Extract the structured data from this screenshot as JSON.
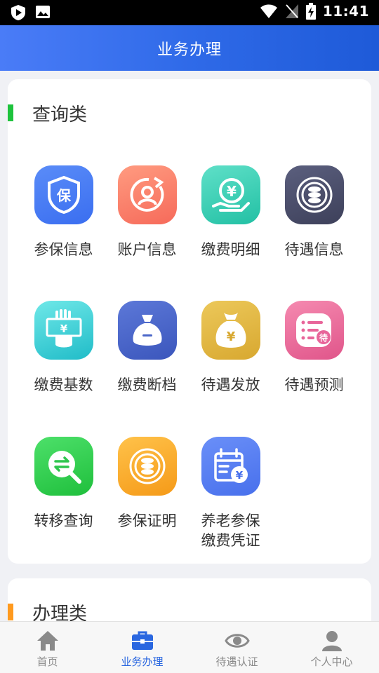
{
  "status_bar": {
    "time": "11:41"
  },
  "header": {
    "title": "业务办理"
  },
  "query_section": {
    "title": "查询类",
    "items": [
      {
        "label": "参保信息",
        "icon": "shield-bao-icon",
        "color_from": "#5a8cf8",
        "color_to": "#3a6ef0"
      },
      {
        "label": "账户信息",
        "icon": "account-cycle-icon",
        "color_from": "#ff9b80",
        "color_to": "#f66a5a"
      },
      {
        "label": "缴费明细",
        "icon": "yuan-hand-icon",
        "color_from": "#5fe0c8",
        "color_to": "#22c0a4"
      },
      {
        "label": "待遇信息",
        "icon": "coin-stack-icon",
        "color_from": "#5b5f7e",
        "color_to": "#3d405a"
      },
      {
        "label": "缴费基数",
        "icon": "hand-bill-icon",
        "color_from": "#6fe8e8",
        "color_to": "#20bcc8"
      },
      {
        "label": "缴费断档",
        "icon": "money-bag-icon",
        "color_from": "#5c78d8",
        "color_to": "#3b56bc"
      },
      {
        "label": "待遇发放",
        "icon": "yuan-sack-icon",
        "color_from": "#ecc85a",
        "color_to": "#d8a830"
      },
      {
        "label": "待遇预测",
        "icon": "forecast-list-icon",
        "color_from": "#f58ab0",
        "color_to": "#e0558a"
      },
      {
        "label": "转移查询",
        "icon": "transfer-search-icon",
        "color_from": "#4de06a",
        "color_to": "#1fbf3c"
      },
      {
        "label": "参保证明",
        "icon": "coin-certificate-icon",
        "color_from": "#ffc24a",
        "color_to": "#f59a18"
      },
      {
        "label": "养老参保缴费凭证",
        "label_line1": "养老参保",
        "label_line2": "缴费凭证",
        "icon": "calendar-yuan-icon",
        "color_from": "#6a8ff8",
        "color_to": "#4870ec"
      }
    ]
  },
  "handle_section": {
    "title": "办理类"
  },
  "tabbar": {
    "items": [
      {
        "label": "首页",
        "icon": "home-icon",
        "active": false
      },
      {
        "label": "业务办理",
        "icon": "briefcase-icon",
        "active": true
      },
      {
        "label": "待遇认证",
        "icon": "eye-icon",
        "active": false
      },
      {
        "label": "个人中心",
        "icon": "person-icon",
        "active": false
      }
    ]
  }
}
